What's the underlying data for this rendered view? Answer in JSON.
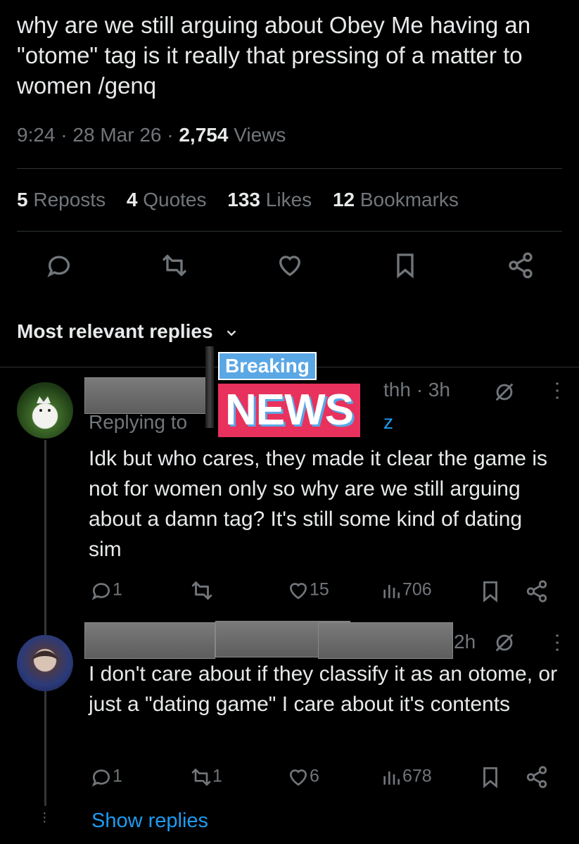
{
  "tweet": {
    "text": "why are we still arguing about Obey Me having an \"otome\" tag is it really that pressing of a matter to women /genq",
    "time": "9:24",
    "sep1": "·",
    "date": "28 Mar 26",
    "sep2": "·",
    "views_count": "2,754",
    "views_label": "Views"
  },
  "stats": {
    "reposts_count": "5",
    "reposts_label": "Reposts",
    "quotes_count": "4",
    "quotes_label": "Quotes",
    "likes_count": "133",
    "likes_label": "Likes",
    "bookmarks_count": "12",
    "bookmarks_label": "Bookmarks"
  },
  "sort": {
    "label": "Most relevant replies"
  },
  "overlay": {
    "breaking": "Breaking",
    "news": "NEWS"
  },
  "replies": [
    {
      "handle_tail": "thh · 3h",
      "replying_prefix": "Replying to",
      "replying_tail": "z",
      "text": "Idk but who cares, they made it clear the game is not for women only so why are we still arguing about a damn tag? It's still some kind of dating sim",
      "comments": "1",
      "likes": "15",
      "views": "706"
    },
    {
      "handle_tail": "2h",
      "text": "I don't care about if they classify it as an otome, or just a \"dating game\" I care about it's contents",
      "comments": "1",
      "reposts": "1",
      "likes": "6",
      "views": "678"
    }
  ],
  "show_replies": "Show replies",
  "colors": {
    "background": "#000000",
    "text": "#e7e9ea",
    "muted": "#71767b",
    "link": "#1d9bf0",
    "news_red": "#e8315c",
    "news_blue": "#5aa7e6"
  }
}
